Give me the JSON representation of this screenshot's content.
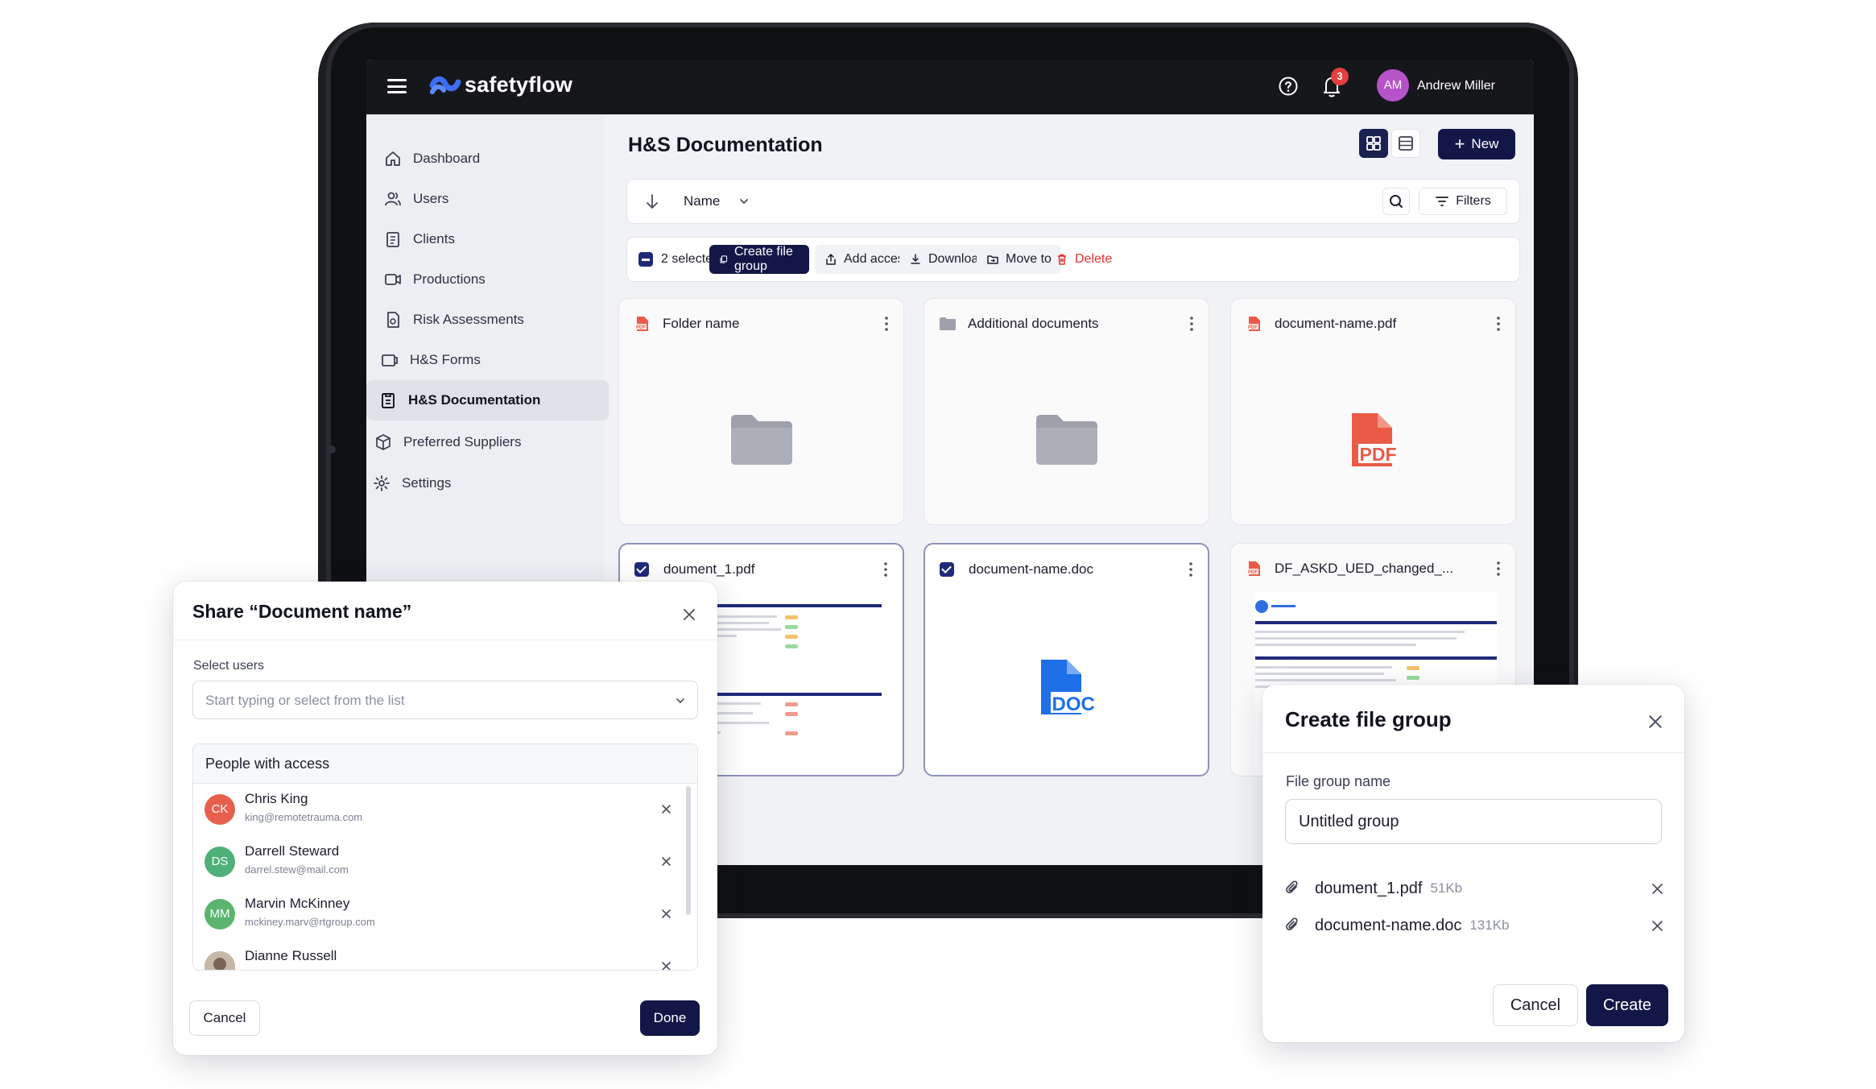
{
  "app": {
    "brand": "safetyflow",
    "notifications_count": "3",
    "user": {
      "initials": "AM",
      "name": "Andrew Miller",
      "avatar_color": "#b653c9"
    }
  },
  "sidebar": {
    "items": [
      {
        "label": "Dashboard",
        "icon": "home-icon"
      },
      {
        "label": "Users",
        "icon": "users-icon"
      },
      {
        "label": "Clients",
        "icon": "clipboard-icon"
      },
      {
        "label": "Productions",
        "icon": "video-icon"
      },
      {
        "label": "Risk Assessments",
        "icon": "risk-doc-icon"
      },
      {
        "label": "H&S Forms",
        "icon": "forms-icon"
      },
      {
        "label": "H&S Documentation",
        "icon": "documentation-icon",
        "active": true
      },
      {
        "label": "Preferred Suppliers",
        "icon": "box-icon"
      },
      {
        "label": "Settings",
        "icon": "gear-icon"
      }
    ]
  },
  "main": {
    "title": "H&S Documentation",
    "new_label": "New",
    "sort_label": "Name",
    "filters_label": "Filters",
    "selection": {
      "selected_label": "2 selected",
      "create_group": "Create file group",
      "add_access": "Add access",
      "download": "Download",
      "move_to": "Move to",
      "delete": "Delete"
    },
    "cards": [
      {
        "name": "Folder name",
        "kind": "folder",
        "selected": false
      },
      {
        "name": "Additional documents",
        "kind": "folder",
        "selected": false
      },
      {
        "name": "document-name.pdf",
        "kind": "pdf",
        "selected": false,
        "badge": "PDF"
      },
      {
        "name": "doument_1.pdf",
        "kind": "preview",
        "selected": true
      },
      {
        "name": "document-name.doc",
        "kind": "doc",
        "selected": true,
        "badge": "DOC"
      },
      {
        "name": "DF_ASKD_UED_changed_...",
        "kind": "preview-rt",
        "selected": false
      }
    ]
  },
  "share_dialog": {
    "title": "Share “Document name”",
    "select_label": "Select users",
    "select_placeholder": "Start typing or select from the list",
    "people_header": "People with access",
    "people": [
      {
        "initials": "CK",
        "name": "Chris King",
        "email": "king@remotetrauma.com",
        "color": "#e8604c"
      },
      {
        "initials": "DS",
        "name": "Darrell Steward",
        "email": "darrel.stew@mail.com",
        "color": "#4fb07a"
      },
      {
        "initials": "MM",
        "name": "Marvin McKinney",
        "email": "mckiney.marv@rtgroup.com",
        "color": "#5cb56f"
      },
      {
        "initials": "",
        "name": "Dianne Russell",
        "email": "",
        "color": "#8a7b6e"
      }
    ],
    "cancel_label": "Cancel",
    "done_label": "Done"
  },
  "group_dialog": {
    "title": "Create file group",
    "name_label": "File group name",
    "name_value": "Untitled group",
    "files": [
      {
        "name": "doument_1.pdf",
        "size": "51Kb"
      },
      {
        "name": "document-name.doc",
        "size": "131Kb"
      }
    ],
    "cancel_label": "Cancel",
    "create_label": "Create"
  },
  "colors": {
    "primary": "#121747",
    "danger": "#e03131",
    "pdf_red": "#ea5a47",
    "doc_blue": "#1f6fe8"
  }
}
